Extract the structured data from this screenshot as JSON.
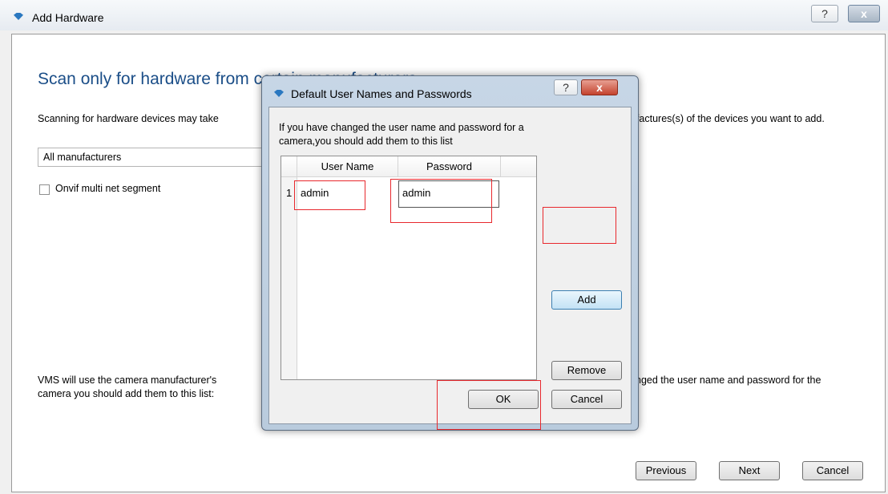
{
  "window": {
    "title": "Add Hardware",
    "help_glyph": "?",
    "close_glyph": "x"
  },
  "main": {
    "heading": "Scan only for hardware from certain manufacturers",
    "description_left": "Scanning for hardware devices may take",
    "description_right": "ufactures(s) of the devices you want to add.",
    "manufacturer_select": "All manufacturers",
    "onvif_checkbox_label": "Onvif multi net segment",
    "onvif_checked": false,
    "vms_note_line1": "VMS will use the camera manufacturer's",
    "vms_note_line2": "camera you should add them to this list:",
    "vms_note_right": "nged the user name and password for the"
  },
  "footer": {
    "previous": "Previous",
    "next": "Next",
    "cancel": "Cancel"
  },
  "dialog": {
    "title": "Default User Names and Passwords",
    "help_glyph": "?",
    "close_glyph": "x",
    "instruction_line1": "If you have changed the user name and password for a",
    "instruction_line2": "camera,you should add them to this list",
    "columns": [
      "User Name",
      "Password"
    ],
    "rows": [
      {
        "index": "1",
        "username": "admin",
        "password": "admin"
      }
    ],
    "add": "Add",
    "remove": "Remove",
    "ok": "OK",
    "cancel": "Cancel"
  },
  "colors": {
    "heading": "#1b4e88",
    "highlight": "#e8282d",
    "icon": "#2a78c0"
  },
  "icons": {
    "window_icon": "app-diamond-icon",
    "dialog_icon": "app-diamond-icon"
  }
}
